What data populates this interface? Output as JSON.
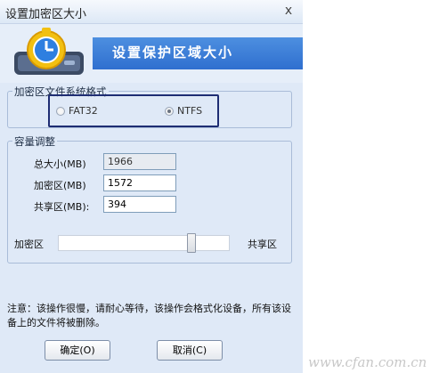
{
  "window": {
    "title": "设置加密区大小",
    "close_glyph": "x"
  },
  "banner": {
    "heading": "设置保护区域大小"
  },
  "fs_group": {
    "legend": "加密区文件系统格式",
    "options": [
      {
        "label": "FAT32",
        "selected": false
      },
      {
        "label": "NTFS",
        "selected": true
      }
    ]
  },
  "capacity_group": {
    "legend": "容量调整",
    "total_label": "总大小(MB)",
    "total_value": "1966",
    "encrypted_label": "加密区(MB)",
    "encrypted_value": "1572",
    "shared_label": "共享区(MB):",
    "shared_value": "394"
  },
  "slider": {
    "left_label": "加密区",
    "right_label": "共享区",
    "position_fraction": 0.8
  },
  "note": "注意：该操作很慢，请耐心等待，该操作会格式化设备，所有该设备上的文件将被删除。",
  "buttons": {
    "ok": "确定(O)",
    "cancel": "取消(C)"
  },
  "watermark": "www.cfan.com.cn",
  "colors": {
    "banner_blue": "#2f6fcf",
    "dialog_bg": "#dfe9f7",
    "highlight_border": "#1e2d73"
  }
}
